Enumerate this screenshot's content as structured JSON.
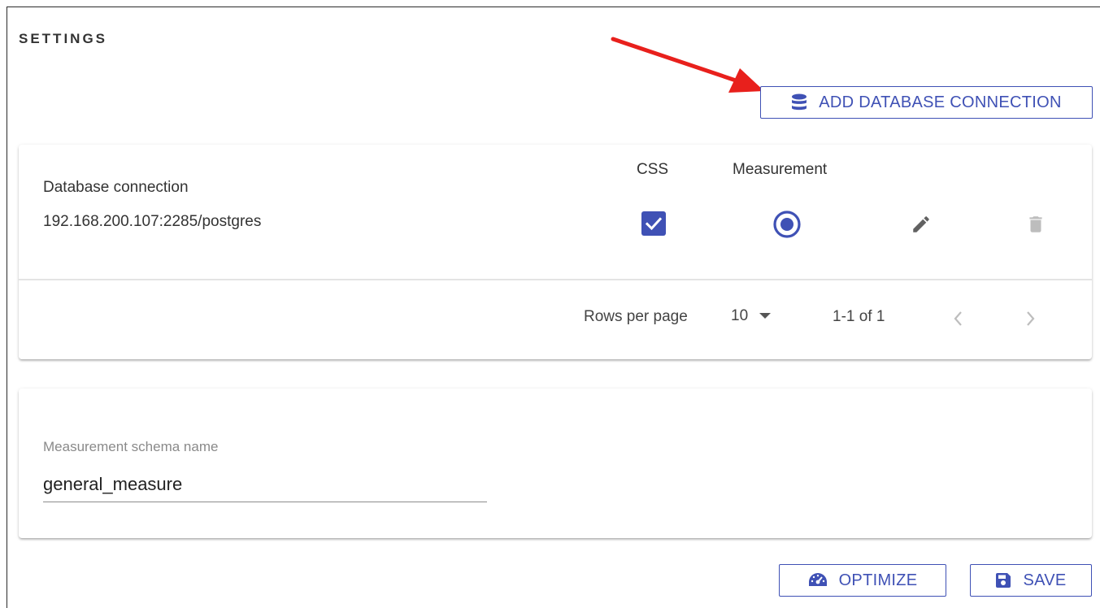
{
  "page": {
    "title": "SETTINGS"
  },
  "toolbar": {
    "add_connection_label": "ADD DATABASE CONNECTION",
    "add_connection_icon": "database-icon"
  },
  "connections_table": {
    "columns": {
      "css": "CSS",
      "measurement": "Measurement"
    },
    "rows": [
      {
        "label": "Database connection",
        "value": "192.168.200.107:2285/postgres",
        "css_checked": true,
        "measurement_selected": true,
        "edit_icon": "pencil-icon",
        "delete_icon": "trash-icon",
        "delete_disabled": true
      }
    ],
    "pagination": {
      "rows_per_page_label": "Rows per page",
      "rows_per_page_value": "10",
      "range_text": "1-1 of 1",
      "prev_icon": "chevron-left-icon",
      "next_icon": "chevron-right-icon"
    }
  },
  "schema": {
    "label": "Measurement schema name",
    "value": "general_measure"
  },
  "actions": {
    "optimize_label": "OPTIMIZE",
    "optimize_icon": "speedometer-icon",
    "save_label": "SAVE",
    "save_icon": "floppy-disk-icon"
  },
  "colors": {
    "accent": "#3f51b5",
    "annotation_arrow": "#e8201c",
    "disabled_icon": "#bdbdbd",
    "edit_icon": "#616161"
  }
}
